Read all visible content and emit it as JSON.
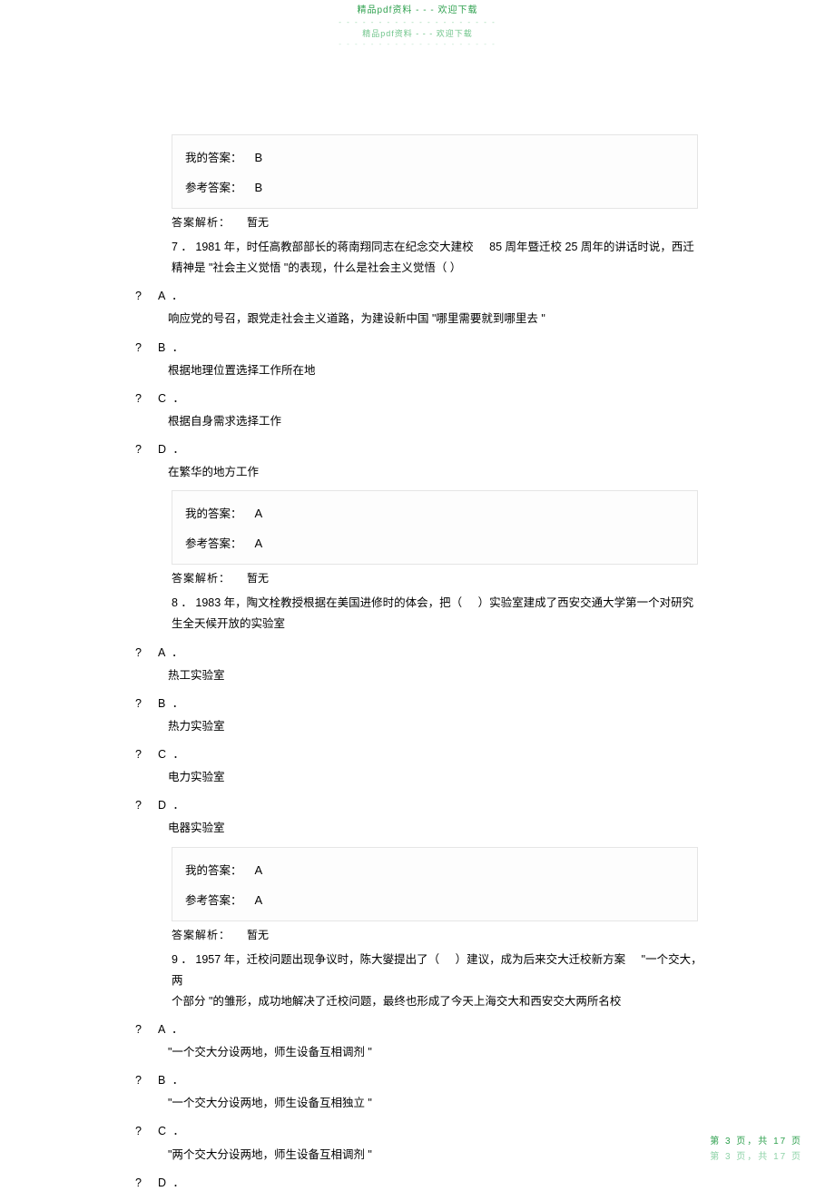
{
  "header": {
    "line1": "精品pdf资料   - - -   欢迎下载",
    "line2": "精品pdf资料   - - -   欢迎下载",
    "dashes": "- - - - - - - - - - - - - - - - - - - -"
  },
  "labels": {
    "my_answer": "我的答案：",
    "ref_answer": "参考答案：",
    "analysis": "答案解析：",
    "analysis_none": "暂无"
  },
  "block6": {
    "my": "B",
    "ref": "B"
  },
  "q7": {
    "stem_p1": "7 ．  1981 年，时任高教部部长的蒋南翔同志在纪念交大建校",
    "stem_p2": "85 周年暨迁校  25 周年的讲话时说，西迁",
    "stem_line2": "精神是 \"社会主义觉悟  \"的表现，什么是社会主义觉悟（      ）",
    "options": {
      "A": "响应党的号召，跟党走社会主义道路，为建设新中国        \"哪里需要就到哪里去   \"",
      "B": "根据地理位置选择工作所在地",
      "C": "根据自身需求选择工作",
      "D": "在繁华的地方工作"
    },
    "my": "A",
    "ref": "A"
  },
  "q8": {
    "stem_p1": "8 ．  1983 年，陶文栓教授根据在美国进修时的体会，把（",
    "stem_p2": "）实验室建成了西安交通大学第一个对研究",
    "stem_line2": "生全天候开放的实验室",
    "options": {
      "A": "热工实验室",
      "B": "热力实验室",
      "C": "电力实验室",
      "D": "电器实验室"
    },
    "my": "A",
    "ref": "A"
  },
  "q9": {
    "stem_p1": "9 ．  1957 年，迁校问题出现争议时，陈大燮提出了（",
    "stem_p2": "）建议，成为后来交大迁校新方案",
    "stem_p3": "\"一个交大，两",
    "stem_line2": "个部分 \"的雏形，成功地解决了迁校问题，最终也形成了今天上海交大和西安交大两所名校",
    "options": {
      "A": "\"一个交大分设两地，师生设备互相调剂      \"",
      "B": "\"一个交大分设两地，师生设备互相独立      \"",
      "C": "\"两个交大分设两地，师生设备互相调剂     \"",
      "D_head": "D ．"
    }
  },
  "footer": {
    "line1": "第  3  页，共  17  页",
    "line2": "第  3  页，共  17  页"
  }
}
